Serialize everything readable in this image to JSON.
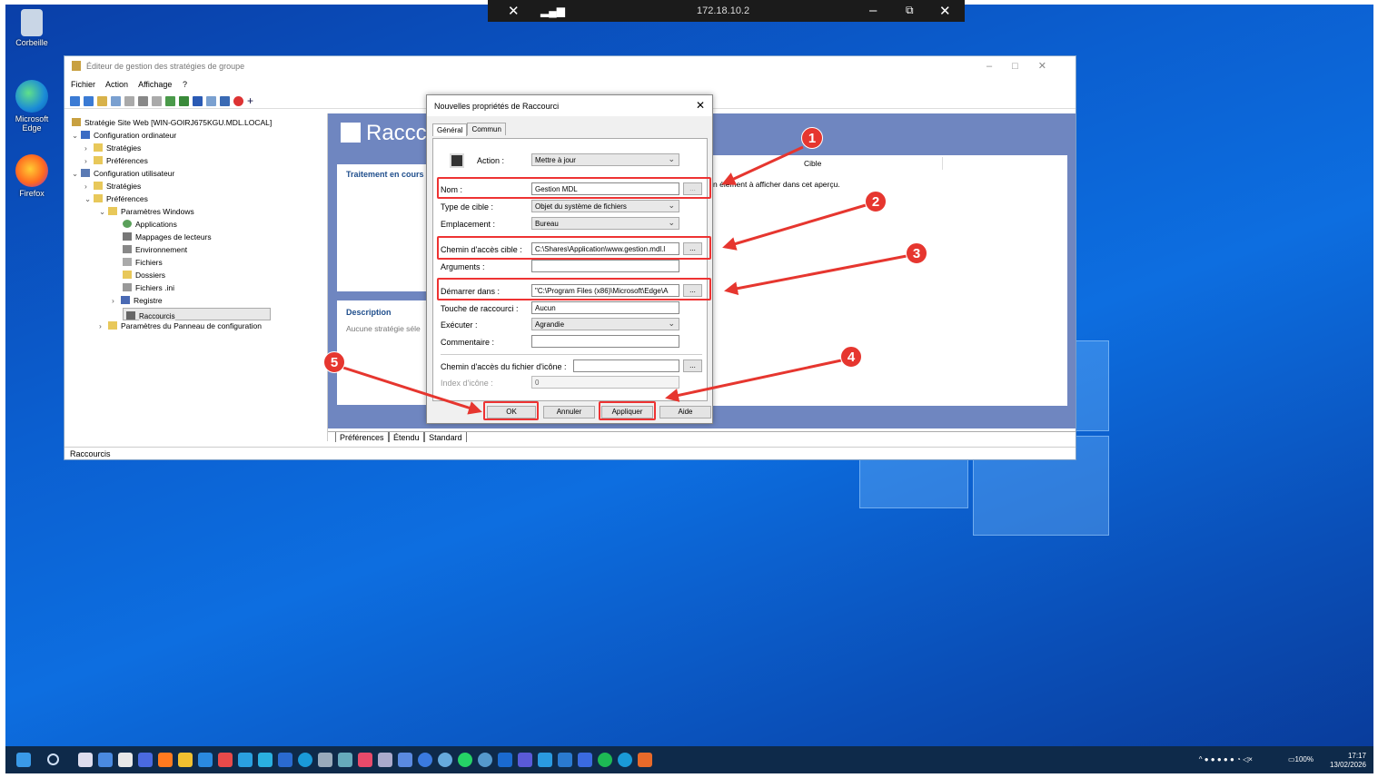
{
  "remote": {
    "ip": "172.18.10.2"
  },
  "desktop": {
    "icons": [
      {
        "label": "Corbeille"
      },
      {
        "label": "Microsoft Edge"
      },
      {
        "label": "Firefox"
      }
    ]
  },
  "gpwindow": {
    "title": "Éditeur de gestion des stratégies de groupe",
    "menu": [
      "Fichier",
      "Action",
      "Affichage",
      "?"
    ],
    "tree": {
      "root": "Stratégie Site Web [WIN-GOIRJ675KGU.MDL.LOCAL]",
      "computer_config": "Configuration ordinateur",
      "strategies": "Stratégies",
      "preferences": "Préférences",
      "user_config": "Configuration utilisateur",
      "win_params": "Paramètres Windows",
      "applications": "Applications",
      "drive_maps": "Mappages de lecteurs",
      "environment": "Environnement",
      "files": "Fichiers",
      "folders": "Dossiers",
      "ini_files": "Fichiers .ini",
      "registry": "Registre",
      "shortcuts": "Raccourcis",
      "control_panel": "Paramètres du Panneau de configuration"
    },
    "right": {
      "header": "Raccc",
      "processing_title": "Traitement en cours",
      "description_title": "Description",
      "description_text": "Aucune stratégie séle",
      "col_target": "Cible",
      "empty_text": "n élément à afficher dans cet aperçu."
    },
    "tabs": [
      "Préférences",
      "Étendu",
      "Standard"
    ],
    "status": "Raccourcis"
  },
  "dialog": {
    "title": "Nouvelles propriétés de Raccourci",
    "tabs": [
      "Général",
      "Commun"
    ],
    "action_label": "Action :",
    "action_value": "Mettre à jour",
    "name_label": "Nom :",
    "name_value": "Gestion MDL",
    "target_type_label": "Type de cible :",
    "target_type_value": "Objet du système de fichiers",
    "location_label": "Emplacement :",
    "location_value": "Bureau",
    "target_path_label": "Chemin d'accès cible :",
    "target_path_value": "C:\\Shares\\Application\\www.gestion.mdl.l",
    "arguments_label": "Arguments :",
    "start_in_label": "Démarrer dans :",
    "start_in_value": "\"C:\\Program Files (x86)\\Microsoft\\Edge\\A",
    "hotkey_label": "Touche de raccourci :",
    "hotkey_value": "Aucun",
    "run_label": "Exécuter :",
    "run_value": "Agrandie",
    "comment_label": "Commentaire :",
    "icon_path_label": "Chemin d'accès du fichier d'icône :",
    "icon_index_label": "Index d'icône :",
    "icon_index_value": "0",
    "browse": "...",
    "ok": "OK",
    "cancel": "Annuler",
    "apply": "Appliquer",
    "help": "Aide"
  },
  "annotations": [
    "1",
    "2",
    "3",
    "4",
    "5"
  ],
  "taskbar": {
    "battery": "100%",
    "time": "17:17",
    "date": "13/02/2026"
  },
  "colors": {
    "desktop": "#0b5fd0",
    "annotation_red": "#e6362f",
    "panel_blue": "#6f86c0"
  }
}
